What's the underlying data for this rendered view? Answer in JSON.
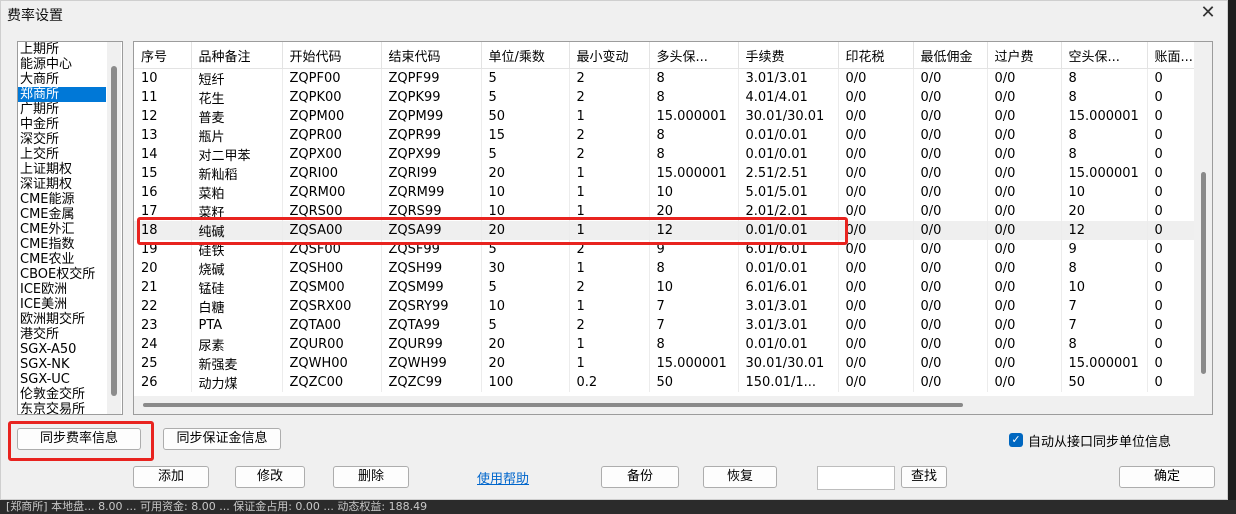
{
  "window": {
    "title": "费率设置"
  },
  "exchanges": [
    "上期所",
    "能源中心",
    "大商所",
    "郑商所",
    "广期所",
    "中金所",
    "深交所",
    "上交所",
    "上证期权",
    "深证期权",
    "CME能源",
    "CME金属",
    "CME外汇",
    "CME指数",
    "CME农业",
    "CBOE权交所",
    "ICE欧洲",
    "ICE美洲",
    "欧洲期交所",
    "港交所",
    "SGX-A50",
    "SGX-NK",
    "SGX-UC",
    "伦敦金交所",
    "东京交易所"
  ],
  "selected_exchange": "郑商所",
  "table": {
    "headers": [
      "序号",
      "品种备注",
      "开始代码",
      "结束代码",
      "单位/乘数",
      "最小变动",
      "多头保...",
      "手续费",
      "印花税",
      "最低佣金",
      "过户费",
      "空头保...",
      "账面..."
    ],
    "rows": [
      [
        "10",
        "短纤",
        "ZQPF00",
        "ZQPF99",
        "5",
        "2",
        "8",
        "3.01/3.01",
        "0/0",
        "0/0",
        "0/0",
        "8",
        "0"
      ],
      [
        "11",
        "花生",
        "ZQPK00",
        "ZQPK99",
        "5",
        "2",
        "8",
        "4.01/4.01",
        "0/0",
        "0/0",
        "0/0",
        "8",
        "0"
      ],
      [
        "12",
        "普麦",
        "ZQPM00",
        "ZQPM99",
        "50",
        "1",
        "15.000001",
        "30.01/30.01",
        "0/0",
        "0/0",
        "0/0",
        "15.000001",
        "0"
      ],
      [
        "13",
        "瓶片",
        "ZQPR00",
        "ZQPR99",
        "15",
        "2",
        "8",
        "0.01/0.01",
        "0/0",
        "0/0",
        "0/0",
        "8",
        "0"
      ],
      [
        "14",
        "对二甲苯",
        "ZQPX00",
        "ZQPX99",
        "5",
        "2",
        "8",
        "0.01/0.01",
        "0/0",
        "0/0",
        "0/0",
        "8",
        "0"
      ],
      [
        "15",
        "新籼稻",
        "ZQRI00",
        "ZQRI99",
        "20",
        "1",
        "15.000001",
        "2.51/2.51",
        "0/0",
        "0/0",
        "0/0",
        "15.000001",
        "0"
      ],
      [
        "16",
        "菜粕",
        "ZQRM00",
        "ZQRM99",
        "10",
        "1",
        "10",
        "5.01/5.01",
        "0/0",
        "0/0",
        "0/0",
        "10",
        "0"
      ],
      [
        "17",
        "菜籽",
        "ZQRS00",
        "ZQRS99",
        "10",
        "1",
        "20",
        "2.01/2.01",
        "0/0",
        "0/0",
        "0/0",
        "20",
        "0"
      ],
      [
        "18",
        "纯碱",
        "ZQSA00",
        "ZQSA99",
        "20",
        "1",
        "12",
        "0.01/0.01",
        "0/0",
        "0/0",
        "0/0",
        "12",
        "0"
      ],
      [
        "19",
        "硅铁",
        "ZQSF00",
        "ZQSF99",
        "5",
        "2",
        "9",
        "6.01/6.01",
        "0/0",
        "0/0",
        "0/0",
        "9",
        "0"
      ],
      [
        "20",
        "烧碱",
        "ZQSH00",
        "ZQSH99",
        "30",
        "1",
        "8",
        "0.01/0.01",
        "0/0",
        "0/0",
        "0/0",
        "8",
        "0"
      ],
      [
        "21",
        "锰硅",
        "ZQSM00",
        "ZQSM99",
        "5",
        "2",
        "10",
        "6.01/6.01",
        "0/0",
        "0/0",
        "0/0",
        "10",
        "0"
      ],
      [
        "22",
        "白糖",
        "ZQSRX00",
        "ZQSRY99",
        "10",
        "1",
        "7",
        "3.01/3.01",
        "0/0",
        "0/0",
        "0/0",
        "7",
        "0"
      ],
      [
        "23",
        "PTA",
        "ZQTA00",
        "ZQTA99",
        "5",
        "2",
        "7",
        "3.01/3.01",
        "0/0",
        "0/0",
        "0/0",
        "7",
        "0"
      ],
      [
        "24",
        "尿素",
        "ZQUR00",
        "ZQUR99",
        "20",
        "1",
        "8",
        "0.01/0.01",
        "0/0",
        "0/0",
        "0/0",
        "8",
        "0"
      ],
      [
        "25",
        "新强麦",
        "ZQWH00",
        "ZQWH99",
        "20",
        "1",
        "15.000001",
        "30.01/30.01",
        "0/0",
        "0/0",
        "0/0",
        "15.000001",
        "0"
      ],
      [
        "26",
        "动力煤",
        "ZQZC00",
        "ZQZC99",
        "100",
        "0.2",
        "50",
        "150.01/1...",
        "0/0",
        "0/0",
        "0/0",
        "50",
        "0"
      ]
    ],
    "highlighted_row": "18"
  },
  "buttons": {
    "sync_rate": "同步费率信息",
    "sync_margin": "同步保证金信息",
    "add": "添加",
    "edit": "修改",
    "delete": "删除",
    "help": "使用帮助",
    "backup": "备份",
    "restore": "恢复",
    "find": "查找",
    "ok": "确定"
  },
  "auto_sync": {
    "label": "自动从接口同步单位信息",
    "checked": true
  },
  "search": {
    "value": ""
  },
  "status_bar": "[郑商所] 本地盘... 8.00  ... 可用资金: 8.00 ... 保证金占用: 0.00  ... 动态权益: 188.49"
}
